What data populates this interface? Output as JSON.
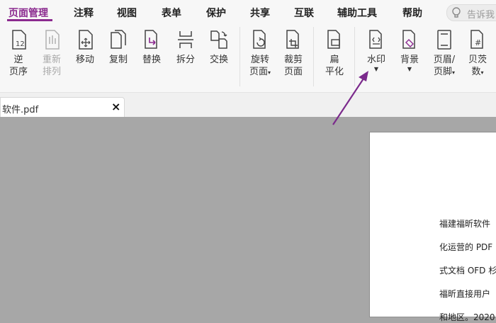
{
  "menu": {
    "items": [
      {
        "label": "页面管理",
        "active": true
      },
      {
        "label": "注释"
      },
      {
        "label": "视图"
      },
      {
        "label": "表单"
      },
      {
        "label": "保护"
      },
      {
        "label": "共享"
      },
      {
        "label": "互联"
      },
      {
        "label": "辅助工具"
      },
      {
        "label": "帮助"
      }
    ],
    "search_placeholder": "告诉我",
    "accent": "#8b2a8f"
  },
  "toolbar": {
    "tools": [
      {
        "id": "reverse",
        "label1": "逆",
        "label2": "页序",
        "icon": "reverse-page-order-icon"
      },
      {
        "id": "reorder",
        "label1": "重新",
        "label2": "排列",
        "icon": "reorder-pages-icon",
        "disabled": true
      },
      {
        "id": "move",
        "label1": "移动",
        "icon": "move-page-icon"
      },
      {
        "id": "copy",
        "label1": "复制",
        "icon": "copy-page-icon"
      },
      {
        "id": "replace",
        "label1": "替换",
        "icon": "replace-page-icon"
      },
      {
        "id": "split",
        "label1": "拆分",
        "icon": "split-page-icon"
      },
      {
        "id": "swap",
        "label1": "交换",
        "icon": "swap-page-icon"
      },
      {
        "id": "rotate",
        "label1": "旋转",
        "label2": "页面",
        "icon": "rotate-page-icon",
        "dropdown": true
      },
      {
        "id": "crop",
        "label1": "裁剪",
        "label2": "页面",
        "icon": "crop-page-icon"
      },
      {
        "id": "flatten",
        "label1": "扁",
        "label2": "平化",
        "icon": "flatten-page-icon"
      },
      {
        "id": "watermark",
        "label1": "水印",
        "icon": "watermark-icon",
        "dropdown": true
      },
      {
        "id": "background",
        "label1": "背景",
        "icon": "background-icon",
        "dropdown": true
      },
      {
        "id": "header_footer",
        "label1": "页眉/",
        "label2": "页脚",
        "icon": "header-footer-icon",
        "dropdown": true
      },
      {
        "id": "page_number",
        "label1": "贝茨",
        "label2": "数",
        "icon": "bates-number-icon",
        "dropdown": true
      }
    ]
  },
  "tab": {
    "title": "软件.pdf",
    "close": "×"
  },
  "document": {
    "lines": [
      "福建福昕软件",
      "化运营的 PDF",
      "式文档 OFD 杉",
      "福昕直接用户",
      "和地区。2020"
    ]
  }
}
